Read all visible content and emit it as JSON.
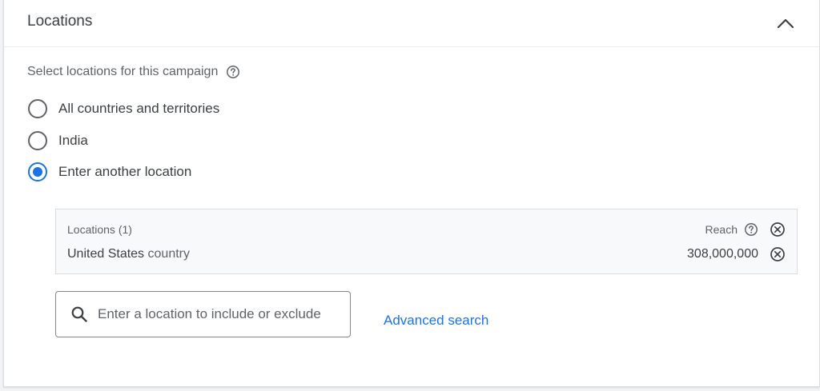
{
  "header": {
    "title": "Locations"
  },
  "section": {
    "subtitle": "Select locations for this campaign"
  },
  "radio_options": [
    {
      "label": "All countries and territories",
      "checked": false
    },
    {
      "label": "India",
      "checked": false
    },
    {
      "label": "Enter another location",
      "checked": true
    }
  ],
  "locations_box": {
    "header_label": "Locations (1)",
    "reach_label": "Reach",
    "rows": [
      {
        "name": "United States",
        "type": "country",
        "reach": "308,000,000"
      }
    ]
  },
  "search": {
    "placeholder": "Enter a location to include or exclude"
  },
  "advanced_search_label": "Advanced search",
  "colors": {
    "accent": "#1a73e8",
    "text": "#3c4043",
    "secondary_text": "#5f6368"
  },
  "icons": [
    "chevron-up-icon",
    "help-icon",
    "remove-icon",
    "search-icon"
  ]
}
